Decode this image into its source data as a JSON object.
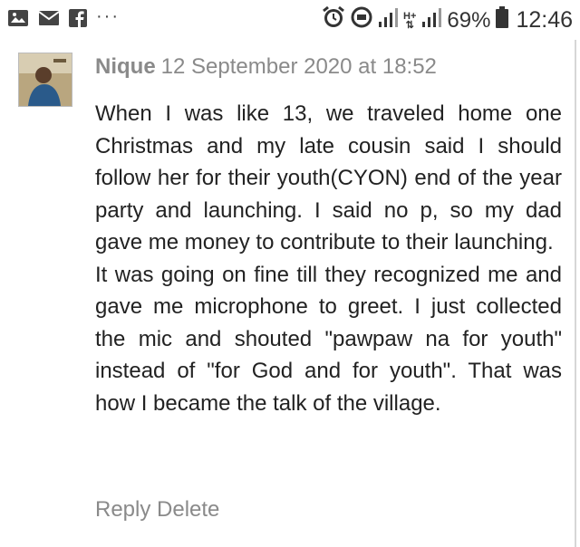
{
  "status_bar": {
    "left_icons": [
      "image-icon",
      "mail-icon",
      "facebook-icon"
    ],
    "overflow": "···",
    "right_icons": [
      "alarm-icon",
      "data-saver-icon",
      "signal-icon",
      "hplus-icon",
      "signal-icon"
    ],
    "hplus_label": "H+",
    "battery_percent": "69%",
    "time": "12:46"
  },
  "comment": {
    "author": "Nique",
    "date": "12 September 2020 at 18:52",
    "paragraphs": [
      "When I was like 13, we traveled home one Christmas and my late cousin said I should follow her for their youth(CYON) end of the year party and launching. I said no p, so my dad gave me money to contribute to their launching.",
      "It was going on fine till they recognized me and gave me microphone to greet. I just collected the mic and shouted \"pawpaw na for youth\" instead of \"for God and for youth\". That was how I became the talk of the village."
    ],
    "actions": {
      "reply": "Reply",
      "delete": "Delete"
    }
  }
}
